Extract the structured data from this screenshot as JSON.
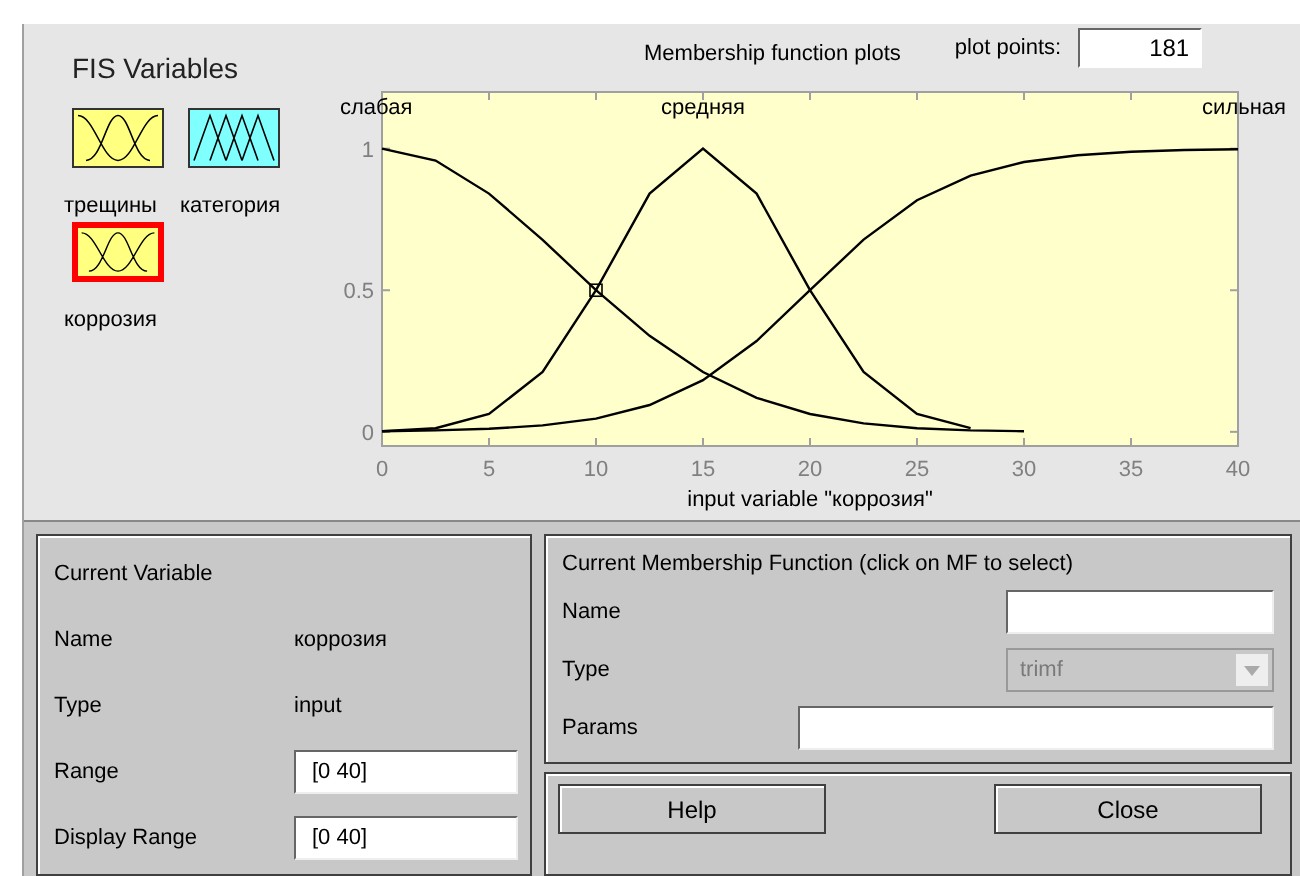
{
  "fis_variables": {
    "title": "FIS Variables",
    "variables": [
      {
        "name": "трещины",
        "kind": "input",
        "selected": false
      },
      {
        "name": "категория",
        "kind": "output",
        "selected": false
      },
      {
        "name": "коррозия",
        "kind": "input",
        "selected": true
      }
    ]
  },
  "plot_header": {
    "plot_points_label": "plot points:",
    "plot_points": "181"
  },
  "plot": {
    "chart_data": {
      "type": "line",
      "title": "Membership function plots",
      "xlabel": "input variable \"коррозия\"",
      "x": [
        0,
        2.5,
        5,
        7.5,
        10,
        12.5,
        15,
        17.5,
        20,
        22.5,
        25,
        27.5,
        30,
        32.5,
        35,
        37.5,
        40
      ],
      "xlim": [
        0,
        40
      ],
      "ylim": [
        -0.05,
        1.2
      ],
      "xticks": [
        0,
        5,
        10,
        15,
        20,
        25,
        30,
        35,
        40
      ],
      "yticks": [
        0,
        0.5,
        1
      ],
      "series": [
        {
          "name": "слабая",
          "color": "#000000",
          "values": [
            1,
            0.958,
            0.841,
            0.678,
            0.5,
            0.339,
            0.211,
            0.12,
            0.063,
            0.03,
            0.013,
            0.005,
            0.002,
            null,
            null,
            null,
            null
          ]
        },
        {
          "name": "средняя",
          "color": "#000000",
          "values": [
            0.002,
            0.013,
            0.063,
            0.211,
            0.5,
            0.841,
            1,
            0.841,
            0.5,
            0.211,
            0.063,
            0.013,
            null,
            null,
            null,
            null,
            null
          ]
        },
        {
          "name": "сильная",
          "color": "#000000",
          "values": [
            0.002,
            0.005,
            0.011,
            0.023,
            0.047,
            0.095,
            0.182,
            0.321,
            0.5,
            0.679,
            0.818,
            0.905,
            0.953,
            0.977,
            0.989,
            0.995,
            0.998
          ]
        }
      ]
    }
  },
  "current_variable": {
    "title": "Current Variable",
    "name_label": "Name",
    "name": "коррозия",
    "type_label": "Type",
    "type": "input",
    "range_label": "Range",
    "range": "[0 40]",
    "display_range_label": "Display Range",
    "display_range": "[0 40]"
  },
  "current_mf": {
    "title": "Current Membership Function (click on MF to select)",
    "name_label": "Name",
    "type_label": "Type",
    "type": "trimf",
    "type_disabled": true,
    "params_label": "Params"
  },
  "buttons": [
    {
      "label": "Help"
    },
    {
      "label": "Close"
    }
  ]
}
